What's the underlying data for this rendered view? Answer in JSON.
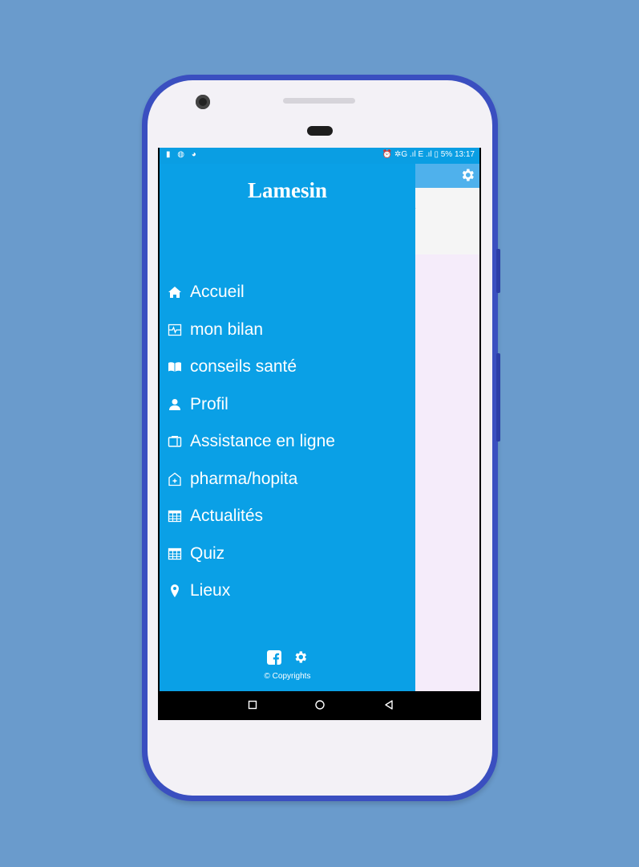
{
  "status_bar": {
    "left_icons": "▮ ◍ ◕",
    "right": "⏰ ✲G .ıl E .ıl ▯ 5%  13:17"
  },
  "background_app": {
    "card_text": "ı",
    "toolbar_icon": "gear-icon"
  },
  "drawer": {
    "title": "Lamesin",
    "items": [
      {
        "label": "Accueil",
        "icon": "home-icon"
      },
      {
        "label": "mon bilan",
        "icon": "heartbeat-icon"
      },
      {
        "label": "conseils santé",
        "icon": "book-icon"
      },
      {
        "label": "Profil",
        "icon": "user-icon"
      },
      {
        "label": "Assistance en ligne",
        "icon": "phone-device-icon"
      },
      {
        "label": "pharma/hopita",
        "icon": "hospital-icon"
      },
      {
        "label": "Actualités",
        "icon": "table-icon"
      },
      {
        "label": "Quiz",
        "icon": "grid-icon"
      },
      {
        "label": "Lieux",
        "icon": "location-pin-icon"
      }
    ],
    "footer": {
      "copyright": "© Copyrights",
      "icons": [
        "facebook-icon",
        "gear-icon"
      ]
    }
  },
  "nav_bar": {
    "buttons": [
      "recents-button",
      "home-button",
      "back-button"
    ]
  },
  "colors": {
    "drawer_bg": "#0aa0e6",
    "toolbar_bg": "#4fb1ec",
    "page_bg": "#6a9bcc",
    "phone_frame": "#3a4fc0"
  }
}
